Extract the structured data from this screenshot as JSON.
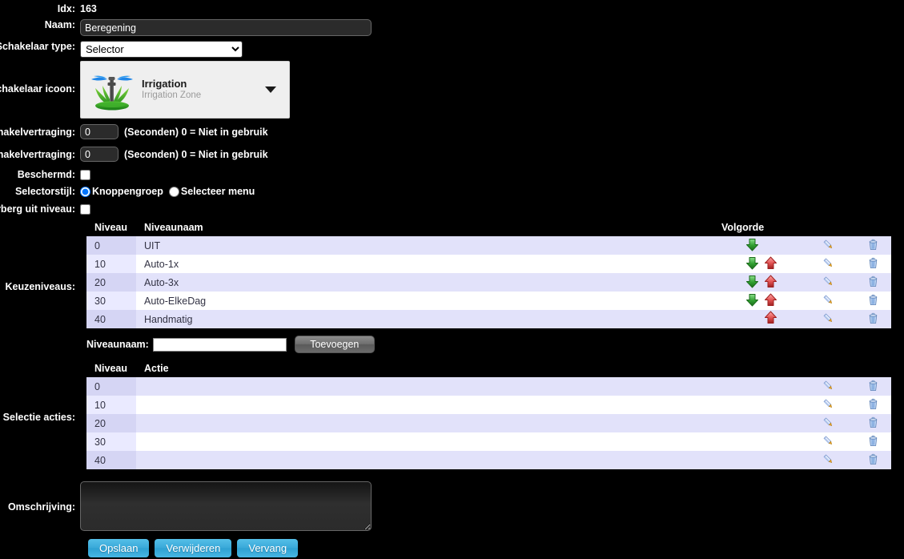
{
  "form": {
    "idx": {
      "label": "Idx:",
      "value": "163"
    },
    "naam": {
      "label": "Naam:",
      "value": "Beregening"
    },
    "switch_type": {
      "label": "Schakelaar type:",
      "value": "Selector"
    },
    "switch_icon": {
      "label": "Schakelaar icoon:",
      "icon_name": "sprinkler-irrigation-icon",
      "title": "Irrigation",
      "subtitle": "Irrigation Zone"
    },
    "on_delay": {
      "label": "Inschakelvertraging:",
      "value": "0",
      "hint": "(Seconden) 0 = Niet in gebruik"
    },
    "off_delay": {
      "label": "Uitschakelvertraging:",
      "value": "0",
      "hint": "(Seconden) 0 = Niet in gebruik"
    },
    "protected": {
      "label": "Beschermd:",
      "checked": false
    },
    "selector_style": {
      "label": "Selectorstijl:",
      "options": [
        "Knoppengroep",
        "Selecteer menu"
      ],
      "selected": "Knoppengroep"
    },
    "hide_off_level": {
      "label": "Verberg uit niveau:",
      "checked": false
    },
    "levels": {
      "label": "Keuzeniveaus:"
    },
    "actions": {
      "label": "Selectie acties:"
    },
    "description": {
      "label": "Omschrijving:",
      "value": ""
    }
  },
  "levels_table": {
    "headers": {
      "level": "Niveau",
      "name": "Niveaunaam",
      "order": "Volgorde",
      "actions": ""
    },
    "rows": [
      {
        "level": "0",
        "name": "UIT",
        "can_down": true,
        "can_up": false
      },
      {
        "level": "10",
        "name": "Auto-1x",
        "can_down": true,
        "can_up": true
      },
      {
        "level": "20",
        "name": "Auto-3x",
        "can_down": true,
        "can_up": true
      },
      {
        "level": "30",
        "name": "Auto-ElkeDag",
        "can_down": true,
        "can_up": true
      },
      {
        "level": "40",
        "name": "Handmatig",
        "can_down": false,
        "can_up": true
      }
    ]
  },
  "add_level": {
    "label": "Niveaunaam:",
    "value": "",
    "button": "Toevoegen"
  },
  "actions_table": {
    "headers": {
      "level": "Niveau",
      "action": "Actie"
    },
    "rows": [
      {
        "level": "0",
        "action": ""
      },
      {
        "level": "10",
        "action": ""
      },
      {
        "level": "20",
        "action": ""
      },
      {
        "level": "30",
        "action": ""
      },
      {
        "level": "40",
        "action": ""
      }
    ]
  },
  "buttons": {
    "save": "Opslaan",
    "delete": "Verwijderen",
    "replace": "Vervang"
  },
  "icons": {
    "edit": "pencil-icon",
    "delete": "trash-icon",
    "move_down": "green-down-arrow-icon",
    "move_up": "red-up-arrow-icon",
    "dropdown": "chevron-down-icon"
  },
  "colors": {
    "background": "#000000",
    "row_odd": "#e2e2fa",
    "row_even": "#ffffff",
    "level_cell_odd": "#d5d5f4",
    "level_cell_even": "#eaeaff",
    "button_blue": "#38a8d8",
    "radio_accent": "#1a6fe0",
    "arrow_down": "#2fa72f",
    "arrow_up": "#e04a4a"
  }
}
